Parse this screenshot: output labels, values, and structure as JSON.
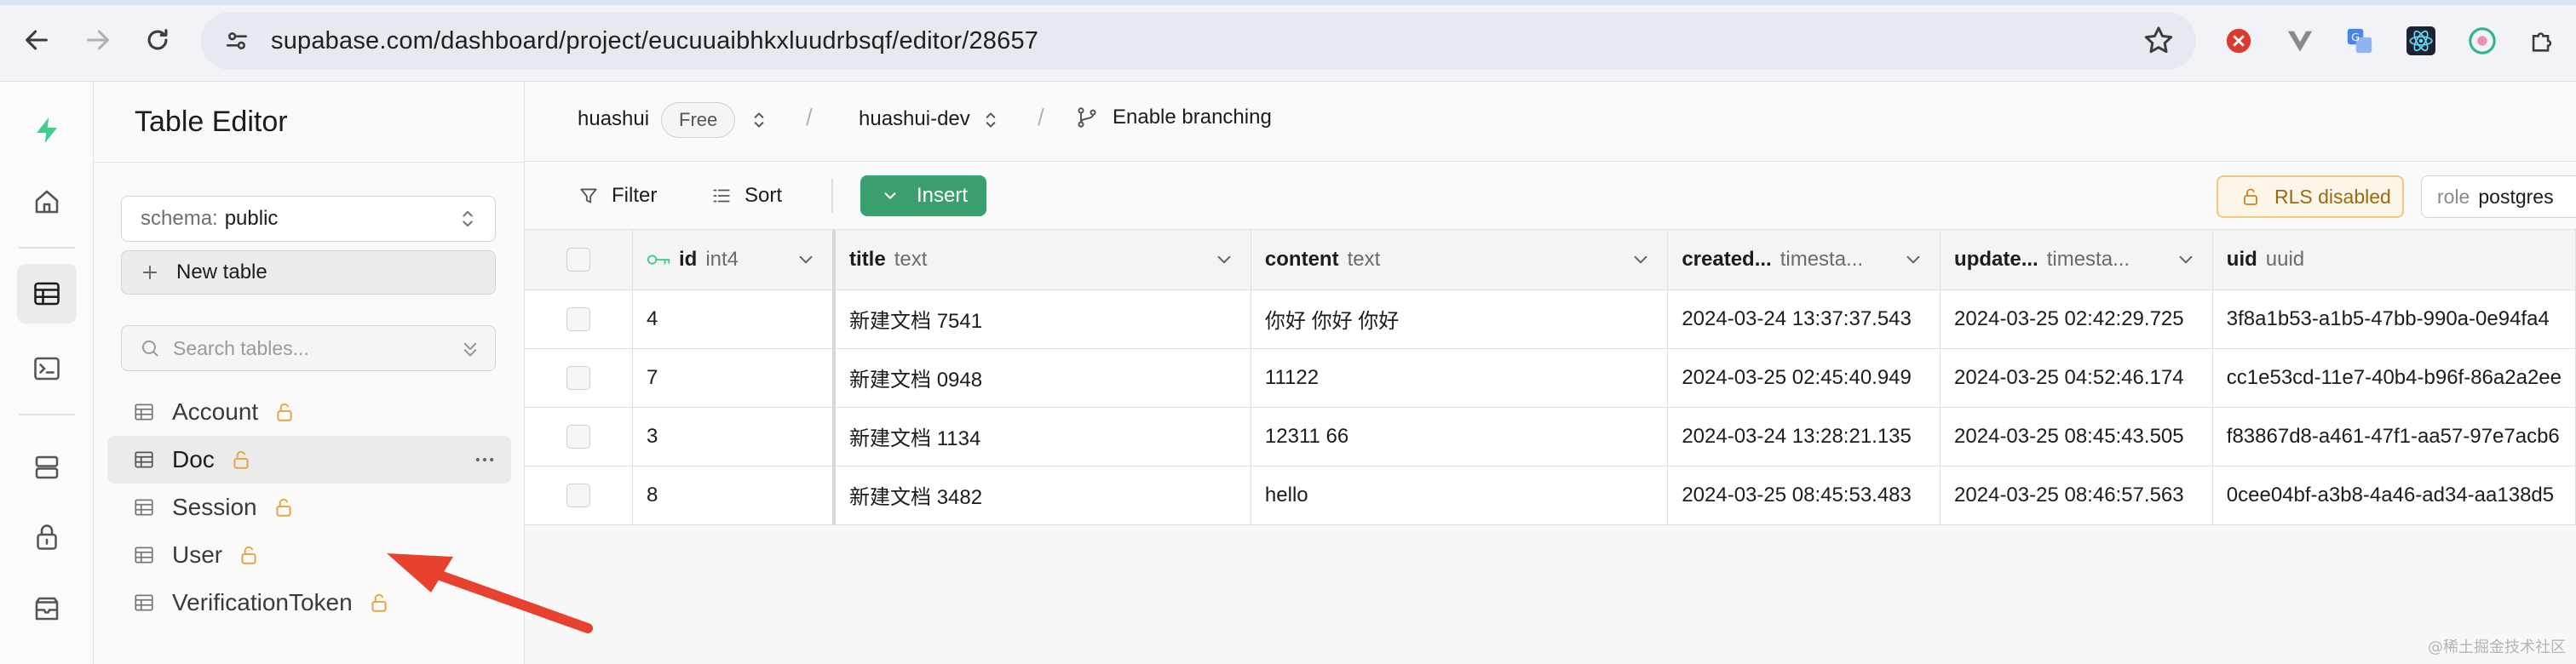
{
  "browser": {
    "url": "supabase.com/dashboard/project/eucuuaibhkxluudrbsqf/editor/28657"
  },
  "sidebar": {
    "title": "Table Editor",
    "schema_label": "schema:",
    "schema_value": "public",
    "new_table_label": "New table",
    "search_placeholder": "Search tables...",
    "tables": [
      {
        "name": "Account"
      },
      {
        "name": "Doc"
      },
      {
        "name": "Session"
      },
      {
        "name": "User"
      },
      {
        "name": "VerificationToken"
      }
    ]
  },
  "header": {
    "org": "huashui",
    "plan": "Free",
    "project": "huashui-dev",
    "branching": "Enable branching",
    "separator": "/"
  },
  "toolbar": {
    "filter": "Filter",
    "sort": "Sort",
    "insert": "Insert",
    "rls": "RLS disabled",
    "role_label": "role",
    "role_value": "postgres"
  },
  "grid": {
    "columns": [
      {
        "name": "id",
        "type": "int4"
      },
      {
        "name": "title",
        "type": "text"
      },
      {
        "name": "content",
        "type": "text"
      },
      {
        "name": "created...",
        "type": "timesta..."
      },
      {
        "name": "update...",
        "type": "timesta..."
      },
      {
        "name": "uid",
        "type": "uuid"
      }
    ],
    "rows": [
      {
        "id": "4",
        "title": "新建文档 7541",
        "content": "你好 你好 你好",
        "created": "2024-03-24 13:37:37.543",
        "updated": "2024-03-25 02:42:29.725",
        "uid": "3f8a1b53-a1b5-47bb-990a-0e94fa4"
      },
      {
        "id": "7",
        "title": "新建文档 0948",
        "content": "11122",
        "created": "2024-03-25 02:45:40.949",
        "updated": "2024-03-25 04:52:46.174",
        "uid": "cc1e53cd-11e7-40b4-b96f-86a2a2ee"
      },
      {
        "id": "3",
        "title": "新建文档 1134",
        "content": "12311 66",
        "created": "2024-03-24 13:28:21.135",
        "updated": "2024-03-25 08:45:43.505",
        "uid": "f83867d8-a461-47f1-aa57-97e7acb6"
      },
      {
        "id": "8",
        "title": "新建文档 3482",
        "content": "hello",
        "created": "2024-03-25 08:45:53.483",
        "updated": "2024-03-25 08:46:57.563",
        "uid": "0cee04bf-a3b8-4a46-ad34-aa138d5"
      }
    ]
  },
  "watermark": "@稀土掘金技术社区",
  "colors": {
    "brand": "#3ecf8e",
    "insert_bg": "#3b9e6e",
    "rls_border": "#f1c77a",
    "annotation_arrow": "#e8412f"
  }
}
